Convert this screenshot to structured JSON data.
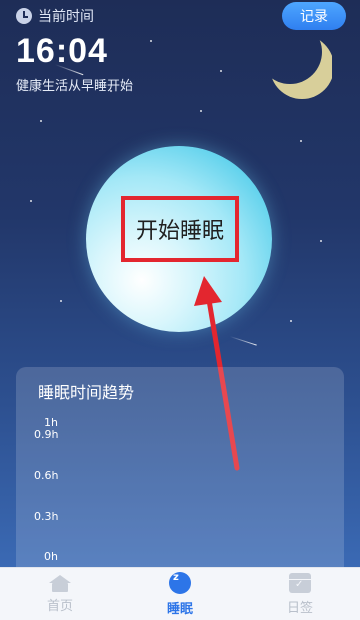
{
  "header": {
    "current_time_label": "当前时间",
    "time": "16:04",
    "slogan": "健康生活从早睡开始",
    "record_button": "记录"
  },
  "main": {
    "start_sleep_label": "开始睡眠"
  },
  "trend": {
    "title": "睡眠时间趋势",
    "y_ticks": [
      "1h",
      "0.9h",
      "0.6h",
      "0.3h",
      "0h"
    ]
  },
  "tabbar": {
    "tabs": [
      {
        "label": "首页",
        "icon": "home-icon",
        "active": false
      },
      {
        "label": "睡眠",
        "icon": "sleep-icon",
        "active": true
      },
      {
        "label": "日签",
        "icon": "calendar-icon",
        "active": false
      }
    ]
  },
  "colors": {
    "accent": "#2d75e8",
    "highlight_border": "#e3262f",
    "annotation_arrow": "#e3262f"
  }
}
